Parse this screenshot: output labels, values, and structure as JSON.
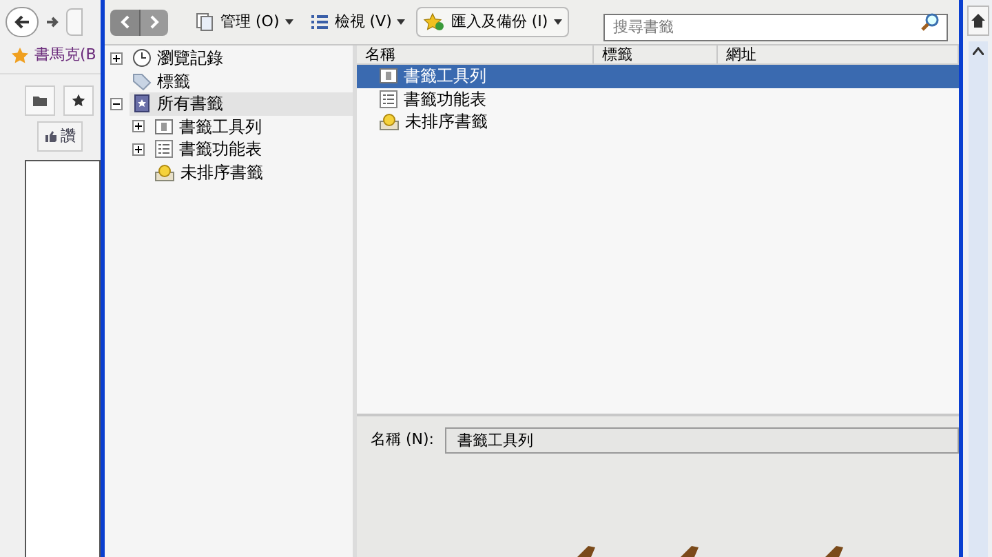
{
  "browser": {
    "bookmark_label": "書馬克(B",
    "like_button": "讚"
  },
  "toolbar": {
    "organize": "管理 (O)",
    "views": "檢視 (V)",
    "import_backup": "匯入及備份 (I)",
    "search": {
      "placeholder": "搜尋書籤"
    }
  },
  "tree": [
    {
      "label": "瀏覽記錄",
      "kind": "history",
      "expanded": false,
      "selected": false
    },
    {
      "label": "標籤",
      "kind": "tag",
      "selected": false
    },
    {
      "label": "所有書籤",
      "kind": "bookmarks",
      "expanded": true,
      "selected": true,
      "children": [
        {
          "label": "書籤工具列",
          "kind": "toolbar",
          "expanded": false,
          "selected": false
        },
        {
          "label": "書籤功能表",
          "kind": "menu",
          "expanded": false,
          "selected": false
        },
        {
          "label": "未排序書籤",
          "kind": "unsorted",
          "selected": false
        }
      ]
    }
  ],
  "table": {
    "columns": [
      "名稱",
      "標籤",
      "網址"
    ],
    "rows": [
      {
        "name": "書籤工具列",
        "kind": "toolbar",
        "selected": true
      },
      {
        "name": "書籤功能表",
        "kind": "menu",
        "selected": false
      },
      {
        "name": "未排序書籤",
        "kind": "unsorted",
        "selected": false
      }
    ]
  },
  "details": {
    "name_label": "名稱 (N):",
    "name_value": "書籤工具列"
  }
}
